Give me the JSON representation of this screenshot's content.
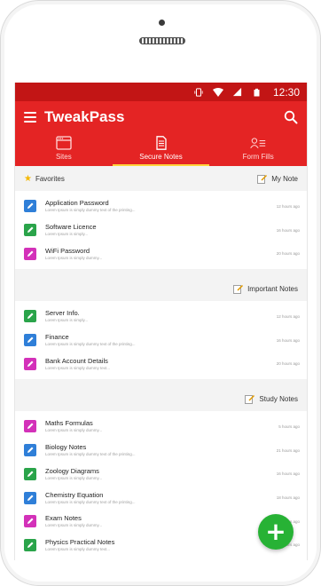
{
  "status": {
    "time": "12:30"
  },
  "app": {
    "title": "TweakPass"
  },
  "tabs": [
    {
      "label": "Sites",
      "icon": "browser-window-icon",
      "active": false
    },
    {
      "label": "Secure Notes",
      "icon": "document-icon",
      "active": true
    },
    {
      "label": "Form Fills",
      "icon": "user-list-icon",
      "active": false
    }
  ],
  "sections": [
    {
      "title": "Favorites",
      "tag": "My Note",
      "items": [
        {
          "name": "Application Password",
          "sub": "Lorem Ipsum is simply dummy text of the printing...",
          "time": "12 hours ago",
          "color": "#2f7fd8"
        },
        {
          "name": "Software Licence",
          "sub": "Lorem Ipsum is simply...",
          "time": "16 hours ago",
          "color": "#2aa44a"
        },
        {
          "name": "WiFi Password",
          "sub": "Lorem Ipsum is simply dummy...",
          "time": "20 hours ago",
          "color": "#d331b9"
        }
      ]
    },
    {
      "title": "",
      "tag": "Important Notes",
      "items": [
        {
          "name": "Server Info.",
          "sub": "Lorem Ipsum is simply...",
          "time": "12 hours ago",
          "color": "#2aa44a"
        },
        {
          "name": "Finance",
          "sub": "Lorem Ipsum is simply dummy text of the printing...",
          "time": "16 hours ago",
          "color": "#2f7fd8"
        },
        {
          "name": "Bank Account Details",
          "sub": "Lorem Ipsum is simply dummy text...",
          "time": "20 hours ago",
          "color": "#d331b9"
        }
      ]
    },
    {
      "title": "",
      "tag": "Study Notes",
      "items": [
        {
          "name": "Maths Formulas",
          "sub": "Lorem Ipsum is simply dummy...",
          "time": "5 hours ago",
          "color": "#d331b9"
        },
        {
          "name": "Biology Notes",
          "sub": "Lorem Ipsum is simply dummy text of the printing...",
          "time": "21 hours ago",
          "color": "#2f7fd8"
        },
        {
          "name": "Zoology Diagrams",
          "sub": "Lorem Ipsum is simply dummy...",
          "time": "16 hours ago",
          "color": "#2aa44a"
        },
        {
          "name": "Chemistry Equation",
          "sub": "Lorem Ipsum is simply dummy text of the printing...",
          "time": "18 hours ago",
          "color": "#2f7fd8"
        },
        {
          "name": "Exam Notes",
          "sub": "Lorem Ipsum is simply dummy...",
          "time": "19 hours ago",
          "color": "#d331b9"
        },
        {
          "name": "Physics Practical Notes",
          "sub": "Lorem Ipsum is simply dummy text...",
          "time": "20 hours ago",
          "color": "#2aa44a"
        }
      ]
    }
  ],
  "colors": {
    "statusbar": "#c21515",
    "appbar": "#e42424",
    "accent": "#ffd43b",
    "fab": "#27b235"
  }
}
